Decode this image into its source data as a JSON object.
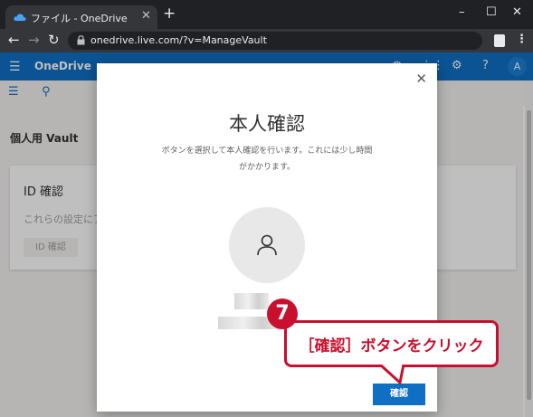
{
  "browser": {
    "tab_title": "ファイル - OneDrive",
    "tab_close": "✕",
    "new_tab": "+",
    "url": "onedrive.live.com/?v=ManageVault",
    "window_controls": [
      "–",
      "☐",
      "✕"
    ]
  },
  "app": {
    "brand": "OneDrive",
    "avatar_initial": "A"
  },
  "page": {
    "vault_title": "個人用 Vault",
    "card_title": "ID 確認",
    "card_desc": "これらの設定にア",
    "card_button": "ID 確認"
  },
  "modal": {
    "close": "✕",
    "title": "本人確認",
    "description": "ボタンを選択して本人確認を行います。これには少し時間がかかります。",
    "confirm_button": "確認"
  },
  "annotation": {
    "step_number": "7",
    "callout_text": "［確認］ボタンをクリック"
  },
  "colors": {
    "accent": "#0f6fc4",
    "annotation": "#c8102e"
  }
}
